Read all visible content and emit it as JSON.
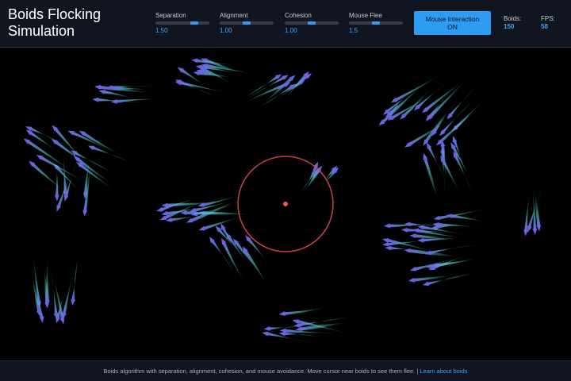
{
  "header": {
    "title": "Boids Flocking Simulation"
  },
  "sliders": [
    {
      "label": "Separation",
      "value": "1.50",
      "fraction": 0.75
    },
    {
      "label": "Alignment",
      "value": "1.00",
      "fraction": 0.5
    },
    {
      "label": "Cohesion",
      "value": "1.00",
      "fraction": 0.5
    },
    {
      "label": "Mouse Flee",
      "value": "1.5",
      "fraction": 0.5
    }
  ],
  "mouse_button": {
    "line1": "Mouse Interaction",
    "line2": "ON"
  },
  "stats": {
    "boids_label": "Boids:",
    "boids_value": "150",
    "fps_label": "FPS:",
    "fps_value": "58"
  },
  "footer": {
    "text": "Boids algorithm with separation, alignment, cohesion, and mouse avoidance. Move cursor near boids to see them flee. | ",
    "link": "Learn about boids"
  },
  "colors": {
    "accent": "#2e9cf2",
    "boid_head": "#6b63e0",
    "boid_tail": "#4fd8c8",
    "flee_ring": "#e04848"
  }
}
